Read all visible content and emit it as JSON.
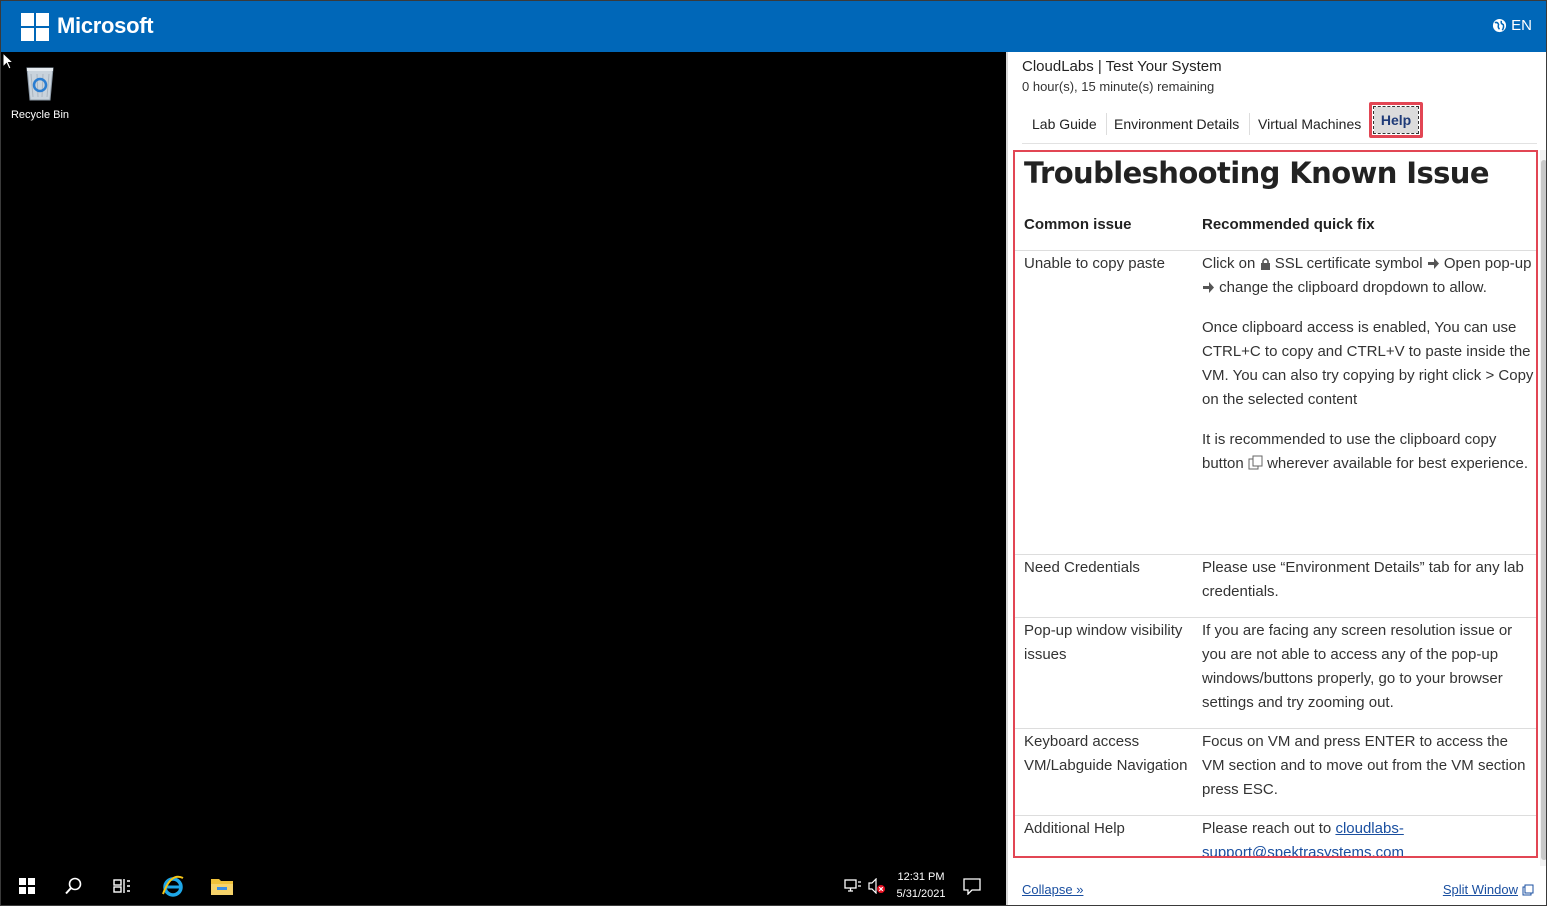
{
  "header": {
    "brand": "Microsoft",
    "language": "EN",
    "bg_color": "#0067b8"
  },
  "desktop": {
    "icons": [
      {
        "label": "Recycle Bin",
        "icon": "recycle-bin-icon"
      }
    ],
    "taskbar": {
      "buttons": [
        "start-icon",
        "search-icon",
        "task-view-icon",
        "internet-explorer-icon",
        "file-explorer-icon"
      ],
      "tray_icons": [
        "network-icon",
        "volume-muted-icon",
        "action-center-icon"
      ],
      "time": "12:31 PM",
      "date": "5/31/2021"
    }
  },
  "panel": {
    "title": "CloudLabs | Test Your System",
    "time_remaining": "0 hour(s), 15 minute(s) remaining",
    "tabs": [
      {
        "label": "Lab Guide"
      },
      {
        "label": "Environment Details"
      },
      {
        "label": "Virtual Machines"
      },
      {
        "label": "Help",
        "active": true
      }
    ],
    "help": {
      "title": "Troubleshooting Known Issue",
      "col1": "Common issue",
      "col2": "Recommended quick fix",
      "rows": [
        {
          "issue": "Unable to copy paste",
          "fix_1a": "Click on",
          "fix_1b": "SSL certificate symbol",
          "fix_1c": "Open pop-up",
          "fix_1d": "change the clipboard dropdown to allow.",
          "fix_2": "Once clipboard access is enabled, You can use CTRL+C to copy and CTRL+V to paste inside the VM. You can also try copying by right click > Copy on the selected content",
          "fix_3a": "It is recommended to use the clipboard copy button",
          "fix_3b": "wherever available for best experience."
        },
        {
          "issue": "Need Credentials",
          "fix": "Please use “Environment Details” tab for any lab credentials."
        },
        {
          "issue": "Pop-up window visibility issues",
          "fix": "If you are facing any screen resolution issue or you are not able to access any of the pop-up windows/buttons properly, go to your browser settings and try zooming out."
        },
        {
          "issue": "Keyboard access VM/Labguide Navigation",
          "fix": "Focus on VM and press ENTER to access the VM section and to move out from the VM section press ESC."
        },
        {
          "issue": "Additional Help",
          "fix_prefix": "Please reach out to",
          "link": "cloudlabs-support@spektrasystems.com"
        }
      ]
    },
    "footer": {
      "collapse": "Collapse »",
      "split_window": "Split Window"
    },
    "highlight_color": "#e24654"
  }
}
